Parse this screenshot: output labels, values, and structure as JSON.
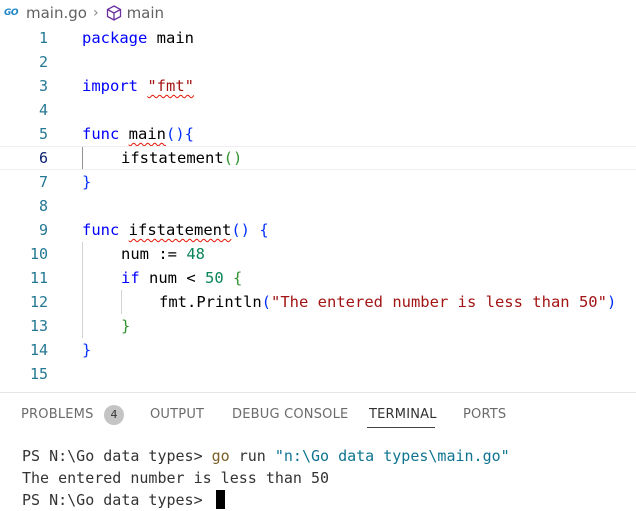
{
  "breadcrumb": {
    "go_icon": "GO",
    "file": "main.go",
    "separator": "›",
    "symbol": "main"
  },
  "editor": {
    "line_numbers": [
      "1",
      "2",
      "3",
      "4",
      "5",
      "6",
      "7",
      "8",
      "9",
      "10",
      "11",
      "12",
      "13",
      "14",
      "15"
    ],
    "current_line": 6,
    "lines": {
      "l1": [
        "package",
        " main"
      ],
      "l3": [
        "import",
        " ",
        "\"fmt\""
      ],
      "l5": [
        "func",
        " ",
        "main",
        "()",
        "{"
      ],
      "l6": [
        "ifstatement",
        "()"
      ],
      "l7": [
        "}"
      ],
      "l9": [
        "func",
        " ",
        "ifstatement",
        "()",
        " ",
        "{"
      ],
      "l10": [
        "num := ",
        "48"
      ],
      "l11": [
        "if",
        " num < ",
        "50",
        " ",
        "{"
      ],
      "l12": [
        "fmt.Println",
        "(",
        "\"The entered number is less than 50\"",
        ")"
      ],
      "l13": [
        "}"
      ],
      "l14": [
        "}"
      ]
    }
  },
  "panel": {
    "tabs": [
      {
        "label": "PROBLEMS",
        "badge": "4"
      },
      {
        "label": "OUTPUT"
      },
      {
        "label": "DEBUG CONSOLE"
      },
      {
        "label": "TERMINAL",
        "active": true
      },
      {
        "label": "PORTS"
      }
    ],
    "terminal": {
      "line1_prompt": "PS N:\\Go data types> ",
      "line1_cmd": "go",
      "line1_run": " run ",
      "line1_arg": "\"n:\\Go data types\\main.go\"",
      "line2": "The entered number is less than 50",
      "line3_prompt": "PS N:\\Go data types> "
    }
  },
  "colors": {
    "keyword": "#0000ff",
    "string": "#a31515",
    "number": "#098658",
    "line_number": "#237893",
    "error_squiggle": "#e51400"
  }
}
